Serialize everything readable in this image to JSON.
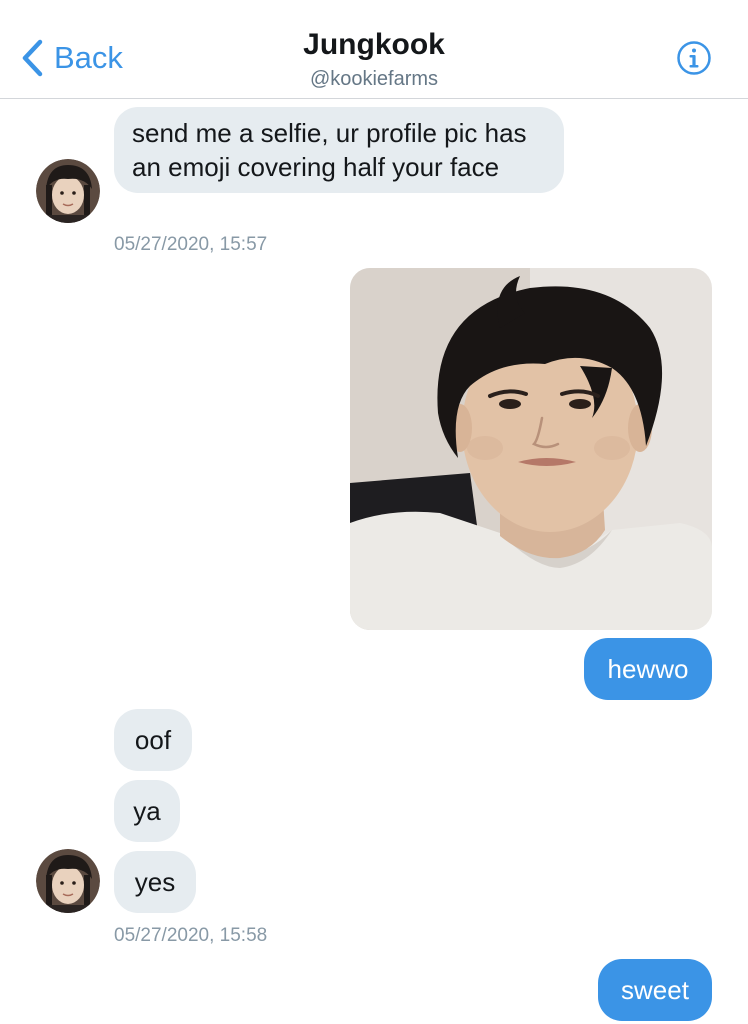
{
  "header": {
    "back_label": "Back",
    "contact_name": "Jungkook",
    "contact_handle": "@kookiefarms",
    "info_icon": "info-circle-icon",
    "back_icon": "chevron-left-icon"
  },
  "messages": [
    {
      "sender": "them",
      "text": "send me a selfie, ur profile pic has an emoji covering half your face"
    },
    {
      "sender": "them",
      "timestamp": "05/27/2020, 15:57"
    },
    {
      "sender": "me",
      "type": "image",
      "description": "selfie photo"
    },
    {
      "sender": "me",
      "text": "hewwo"
    },
    {
      "sender": "them",
      "text": "oof"
    },
    {
      "sender": "them",
      "text": "ya"
    },
    {
      "sender": "them",
      "text": "yes"
    },
    {
      "sender": "them",
      "timestamp": "05/27/2020, 15:58"
    },
    {
      "sender": "me",
      "text": "sweet"
    }
  ],
  "colors": {
    "accent": "#3b94e6",
    "incoming_bubble": "#e6ecf0",
    "timestamp_text": "#8899a6",
    "divider": "#d3d6da"
  }
}
